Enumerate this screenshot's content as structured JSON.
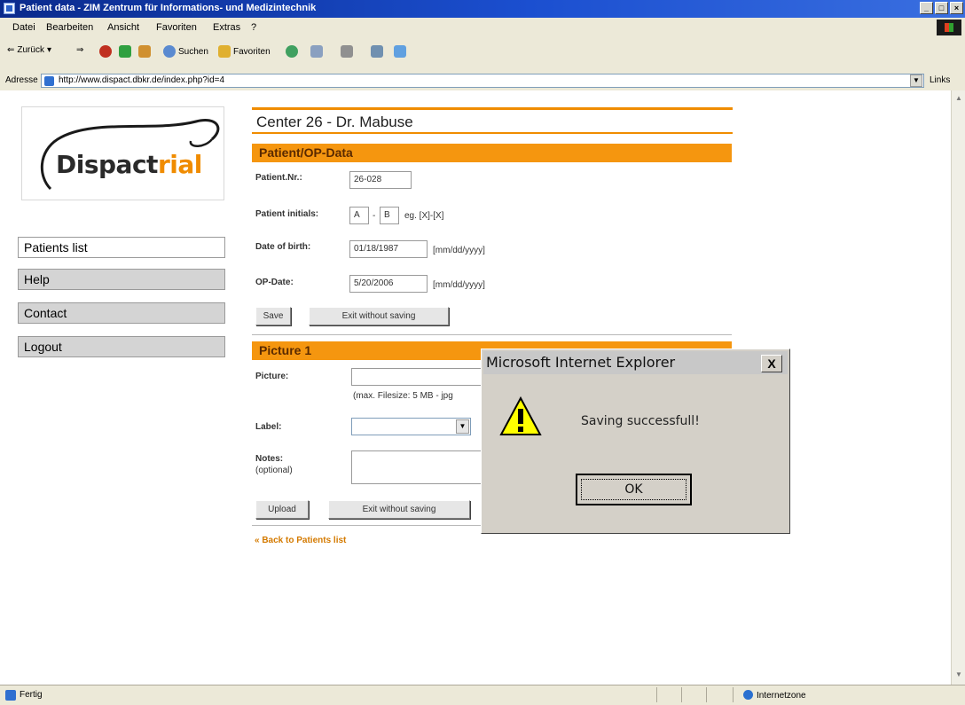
{
  "window": {
    "title": "Patient data - ZIM Zentrum für Informations- und Medizintechnik"
  },
  "menu": [
    "Datei",
    "Bearbeiten",
    "Ansicht",
    "Favoriten",
    "Extras",
    "?"
  ],
  "toolbar": {
    "back": "Zurück",
    "search": "Suchen",
    "favorites": "Favoriten"
  },
  "address": {
    "label": "Adresse",
    "url": "http://www.dispact.dbkr.de/index.php?id=4",
    "links": "Links"
  },
  "logo": {
    "text_main": "Dispact",
    "text_accent": "rial"
  },
  "nav": [
    {
      "label": "Patients list"
    },
    {
      "label": "Help"
    },
    {
      "label": "Contact"
    },
    {
      "label": "Logout"
    }
  ],
  "center_title": "Center 26 - Dr. Mabuse",
  "patient_section": {
    "heading": "Patient/OP-Data",
    "patient_nr_label": "Patient.Nr.:",
    "patient_nr_value": "26-028",
    "initials_label": "Patient initials:",
    "initial_1": "A",
    "initial_sep": "-",
    "initial_2": "B",
    "initials_hint": "eg. [X]-[X]",
    "dob_label": "Date of birth:",
    "dob_value": "01/18/1987",
    "dob_hint": "[mm/dd/yyyy]",
    "opdate_label": "OP-Date:",
    "opdate_value": "5/20/2006",
    "opdate_hint": "[mm/dd/yyyy]",
    "save_label": "Save",
    "exit_label": "Exit without saving"
  },
  "picture_section": {
    "heading": "Picture 1",
    "picture_label": "Picture:",
    "picture_hint": "(max. Filesize: 5 MB - jpg",
    "label_label": "Label:",
    "notes_label": "Notes:",
    "notes_sub": "(optional)",
    "upload_label": "Upload",
    "exit_label": "Exit without saving"
  },
  "back_link": "« Back to Patients list",
  "dialog": {
    "title": "Microsoft Internet Explorer",
    "close": "X",
    "message": "Saving successfull!",
    "ok": "OK"
  },
  "status": {
    "left": "Fertig",
    "zone": "Internetzone"
  },
  "colors": {
    "accent": "#f5960f",
    "nav_bg": "#d4d4d4",
    "dialog_bg": "#d4d0c8"
  }
}
